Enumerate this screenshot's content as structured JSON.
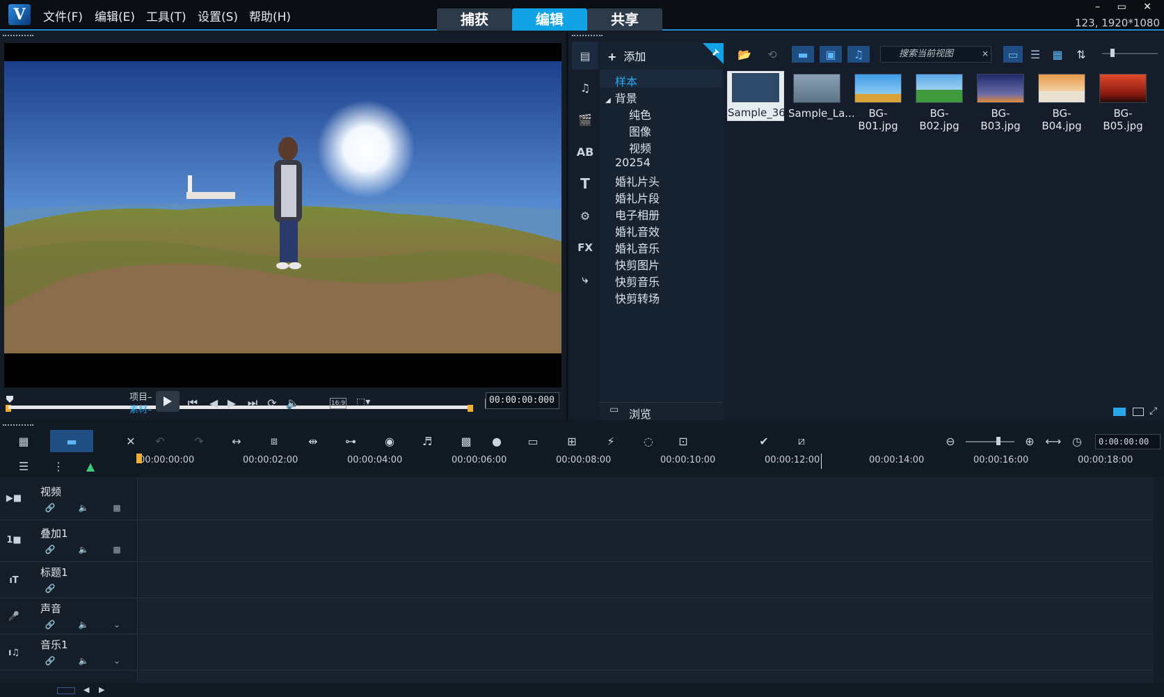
{
  "titlebar": {
    "logo_text": "V",
    "menu": [
      "文件(F)",
      "编辑(E)",
      "工具(T)",
      "设置(S)",
      "帮助(H)"
    ],
    "modes": [
      "捕获",
      "编辑",
      "共享"
    ],
    "active_mode": "编辑",
    "window_buttons": "– ▭ ✕",
    "resolution": "123, 1920*1080"
  },
  "player": {
    "project_label": "项目",
    "clip_label": "素材",
    "aspect": "16:9",
    "timecode": "00:00:00:000",
    "mark_in": "[",
    "mark_out": "]"
  },
  "library": {
    "add_label": "添加",
    "tree": [
      "样本",
      "背景",
      "纯色",
      "图像",
      "视频",
      "20254",
      "婚礼片头",
      "婚礼片段",
      "电子相册",
      "婚礼音效",
      "婚礼音乐",
      "快剪图片",
      "快剪音乐",
      "快剪转场"
    ],
    "browse_label": "浏览",
    "search_placeholder": "搜索当前视图",
    "thumbnails": [
      {
        "name": "Sample_36...",
        "color": "#2d4a6a"
      },
      {
        "name": "Sample_La...",
        "color": "#7d97ad"
      },
      {
        "name": "BG-B01.jpg",
        "color": "#4fa6e8"
      },
      {
        "name": "BG-B02.jpg",
        "color": "#3e9a3a"
      },
      {
        "name": "BG-B03.jpg",
        "color": "#3a4a8a"
      },
      {
        "name": "BG-B04.jpg",
        "color": "#d9823a"
      },
      {
        "name": "BG-B05.jpg",
        "color": "#b2281c"
      }
    ]
  },
  "timeline": {
    "timecode": "0:00:00:00",
    "ruler": [
      "00:00:00:00",
      "00:00:02:00",
      "00:00:04:00",
      "00:00:06:00",
      "00:00:08:00",
      "00:00:10:00",
      "00:00:12:00",
      "00:00:14:00",
      "00:00:16:00",
      "00:00:18:00"
    ],
    "tracks": [
      "视频",
      "叠加1",
      "标题1",
      "声音",
      "音乐1"
    ]
  }
}
